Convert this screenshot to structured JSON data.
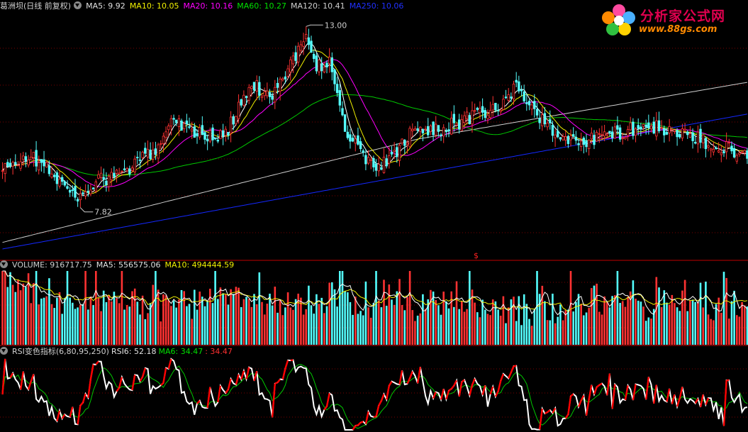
{
  "main": {
    "stock_label": "葛洲坝(日线 前复权)",
    "indicators": [
      {
        "label": "MA5: 9.92",
        "color": "#e0e0e0"
      },
      {
        "label": "MA10: 10.05",
        "color": "#f0f000"
      },
      {
        "label": "MA20: 10.16",
        "color": "#ff00ff"
      },
      {
        "label": "MA60: 10.27",
        "color": "#00e000"
      },
      {
        "label": "MA120: 10.41",
        "color": "#d0d0d0"
      },
      {
        "label": "MA250: 10.06",
        "color": "#2030ff"
      }
    ],
    "high_label": "13.00",
    "low_label": "7.82",
    "marker": "$"
  },
  "volume": {
    "indicators": [
      {
        "label": "VOLUME: 916717.75",
        "color": "#d0d0d0"
      },
      {
        "label": "MA5: 556575.06",
        "color": "#e0e0e0"
      },
      {
        "label": "MA10: 494444.59",
        "color": "#f0f000"
      }
    ]
  },
  "rsi": {
    "indicators": [
      {
        "label": "RSI变色指标(6,80,95,250)",
        "color": "#d0d0d0"
      },
      {
        "label": "RSI6: 52.18",
        "color": "#e0e0e0"
      },
      {
        "label": "MA6: 34.47",
        "color": "#00e000"
      },
      {
        "label": ": 34.47",
        "color": "#ff3030"
      }
    ]
  },
  "watermark": {
    "name": "分析家公式网",
    "url": "www.88gs.com"
  },
  "colors": {
    "up": "#ff3232",
    "down": "#54ffff",
    "grid": "#7a0000",
    "ma5": "#ffffff",
    "ma10": "#f0f000",
    "ma20": "#ff00ff",
    "ma60": "#00c800",
    "ma120": "#d0d0d0",
    "ma250": "#1428ff",
    "rsi_up": "#ff0000",
    "rsi_line": "#ffffff",
    "rsi_ma": "#00c800"
  },
  "chart_data": [
    {
      "type": "candlestick",
      "title": "葛洲坝(日线 前复权)",
      "series": [
        {
          "name": "MA5",
          "last": 9.92
        },
        {
          "name": "MA10",
          "last": 10.05
        },
        {
          "name": "MA20",
          "last": 10.16
        },
        {
          "name": "MA60",
          "last": 10.27
        },
        {
          "name": "MA120",
          "last": 10.41
        },
        {
          "name": "MA250",
          "last": 10.06
        }
      ],
      "annotations": [
        {
          "text": "13.00",
          "kind": "high"
        },
        {
          "text": "7.82",
          "kind": "low"
        }
      ],
      "ylim": [
        6.2,
        13.4
      ],
      "anchors": [
        [
          0,
          8.7
        ],
        [
          10,
          9.2
        ],
        [
          20,
          8.6
        ],
        [
          28,
          7.85
        ],
        [
          34,
          8.3
        ],
        [
          48,
          8.7
        ],
        [
          58,
          9.3
        ],
        [
          66,
          10.3
        ],
        [
          75,
          9.85
        ],
        [
          85,
          9.7
        ],
        [
          96,
          11.3
        ],
        [
          104,
          11.0
        ],
        [
          112,
          12.1
        ],
        [
          117,
          12.65
        ],
        [
          121,
          11.9
        ],
        [
          126,
          12.0
        ],
        [
          132,
          10.0
        ],
        [
          140,
          8.95
        ],
        [
          148,
          8.9
        ],
        [
          158,
          9.9
        ],
        [
          170,
          10.0
        ],
        [
          180,
          10.3
        ],
        [
          192,
          10.6
        ],
        [
          198,
          11.3
        ],
        [
          206,
          10.4
        ],
        [
          216,
          9.6
        ],
        [
          230,
          9.7
        ],
        [
          248,
          10.1
        ],
        [
          266,
          9.7
        ],
        [
          278,
          9.45
        ],
        [
          287,
          9.2
        ]
      ]
    },
    {
      "type": "bar",
      "title": "VOLUME",
      "series": [
        {
          "name": "VOLUME",
          "last": 916717.75
        },
        {
          "name": "MA5",
          "last": 556575.06
        },
        {
          "name": "MA10",
          "last": 494444.59
        }
      ]
    },
    {
      "type": "line",
      "title": "RSI变色指标(6,80,95,250)",
      "series": [
        {
          "name": "RSI6",
          "last": 52.18
        },
        {
          "name": "MA6",
          "last": 34.47
        }
      ],
      "ylim": [
        0,
        100
      ]
    }
  ]
}
